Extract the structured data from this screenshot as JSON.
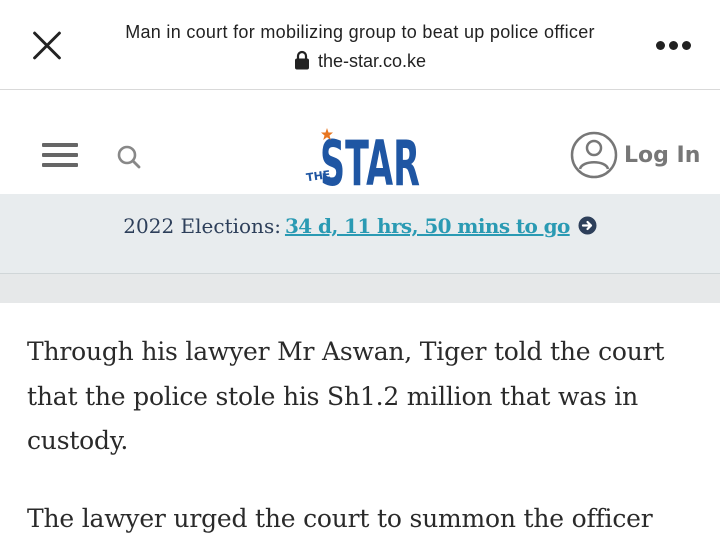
{
  "browser": {
    "page_title": "Man in court for mobilizing group to beat up police officer",
    "url": "the-star.co.ke",
    "icons": {
      "close": "close-icon",
      "lock": "lock-icon",
      "menu": "more-vert-icon"
    }
  },
  "header": {
    "logo": {
      "small_text": "THE",
      "big_text": "STAR",
      "brand_color": "#1f56a3",
      "accent_color": "#e87722"
    },
    "login_label": "Log In",
    "icons": {
      "menu": "hamburger-icon",
      "search": "search-icon",
      "user": "user-icon"
    }
  },
  "countdown": {
    "label": "2022 Elections:",
    "value": "34 d, 11 hrs, 50 mins to go",
    "value_color": "#2a9ab3",
    "icon": "arrow-circle-right-icon"
  },
  "article": {
    "paragraphs": [
      "Through his lawyer Mr Aswan, Tiger told the court that the police stole his Sh1.2 million that was in custody.",
      "The lawyer urged the court to summon the officer"
    ]
  }
}
